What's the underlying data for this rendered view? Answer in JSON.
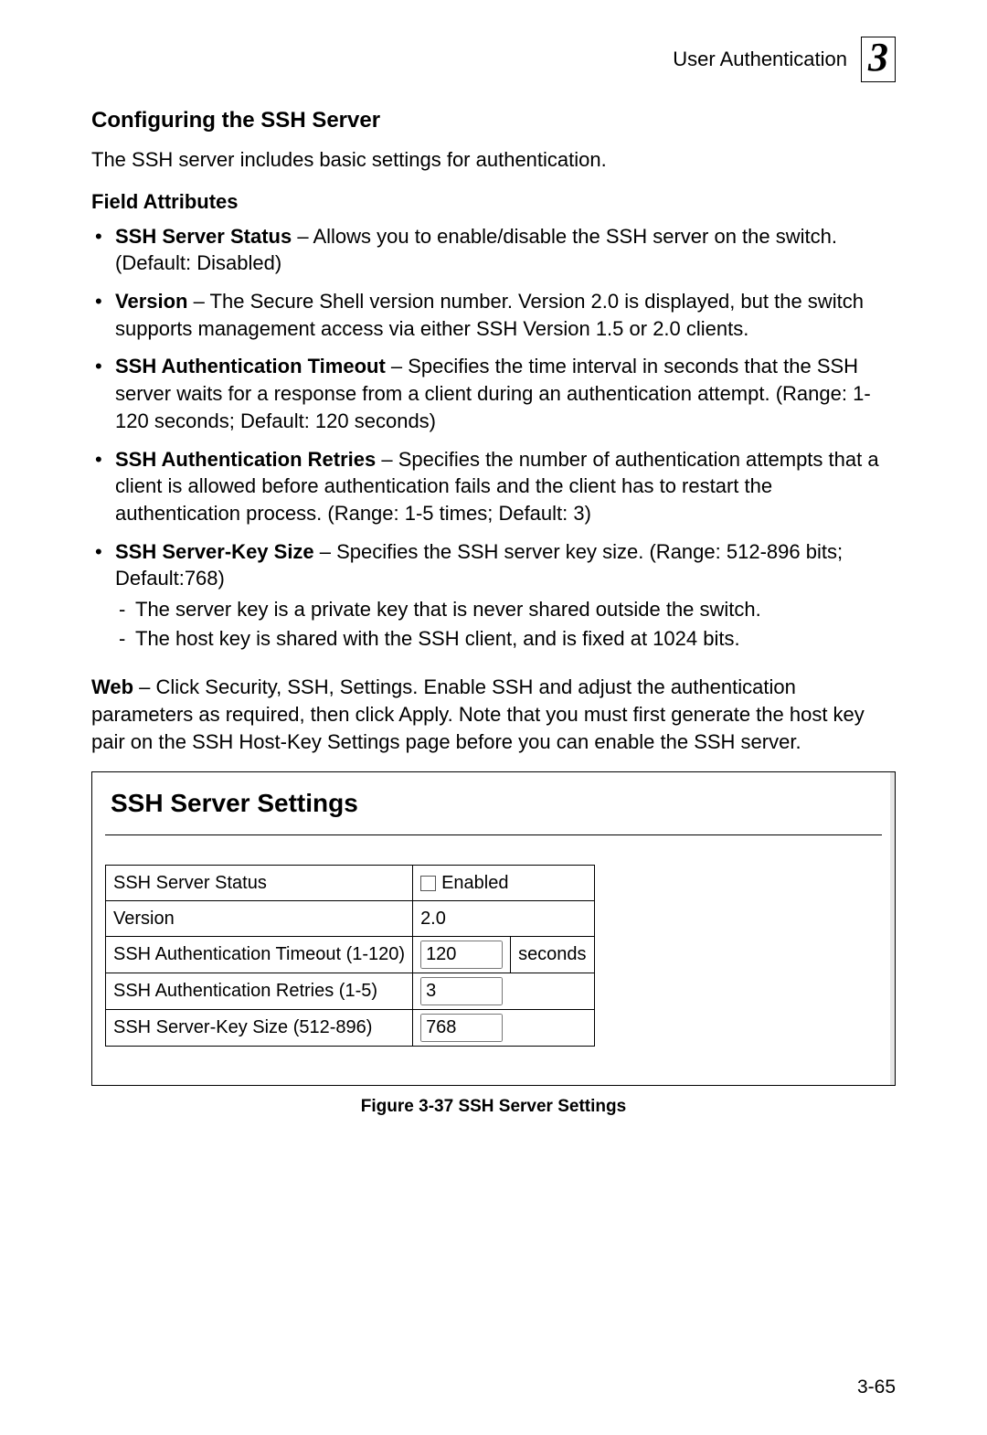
{
  "header": {
    "text": "User Authentication",
    "chapter": "3"
  },
  "section_heading": "Configuring the SSH Server",
  "intro": "The SSH server includes basic settings for authentication.",
  "sub_heading": "Field Attributes",
  "bullets": [
    {
      "bold": "SSH Server Status",
      "rest": " – Allows you to enable/disable the SSH server on the switch. (Default: Disabled)"
    },
    {
      "bold": "Version",
      "rest": " – The Secure Shell version number. Version 2.0 is displayed, but the switch supports management access via either SSH Version 1.5 or 2.0 clients."
    },
    {
      "bold": "SSH Authentication Timeout",
      "rest": " – Specifies the time interval in seconds that the SSH server waits for a response from a client during an authentication attempt. (Range: 1-120 seconds; Default: 120 seconds)"
    },
    {
      "bold": "SSH Authentication Retries",
      "rest": " – Specifies the number of authentication attempts that a client is allowed before authentication fails and the client has to restart the authentication process. (Range: 1-5 times; Default: 3)"
    },
    {
      "bold": "SSH Server-Key Size",
      "rest": " – Specifies the SSH server key size. (Range: 512-896 bits; Default:768)",
      "sub": [
        "The server key is a private key that is never shared outside the switch.",
        "The host key is shared with the SSH client, and is fixed at 1024 bits."
      ]
    }
  ],
  "web_para": {
    "bold": "Web",
    "rest": " – Click Security, SSH, Settings. Enable SSH and adjust the authentication parameters as required, then click Apply. Note that you must first generate the host key pair on the SSH Host-Key Settings page before you can enable the SSH server."
  },
  "panel": {
    "title": "SSH Server Settings",
    "rows": {
      "r1_label": "SSH Server Status",
      "r1_text": "Enabled",
      "r2_label": "Version",
      "r2_value": "2.0",
      "r3_label": "SSH Authentication Timeout (1-120)",
      "r3_value": "120",
      "r3_unit": "seconds",
      "r4_label": "SSH Authentication Retries (1-5)",
      "r4_value": "3",
      "r5_label": "SSH Server-Key Size (512-896)",
      "r5_value": "768"
    }
  },
  "figcaption": "Figure 3-37  SSH Server Settings",
  "page_no": "3-65"
}
